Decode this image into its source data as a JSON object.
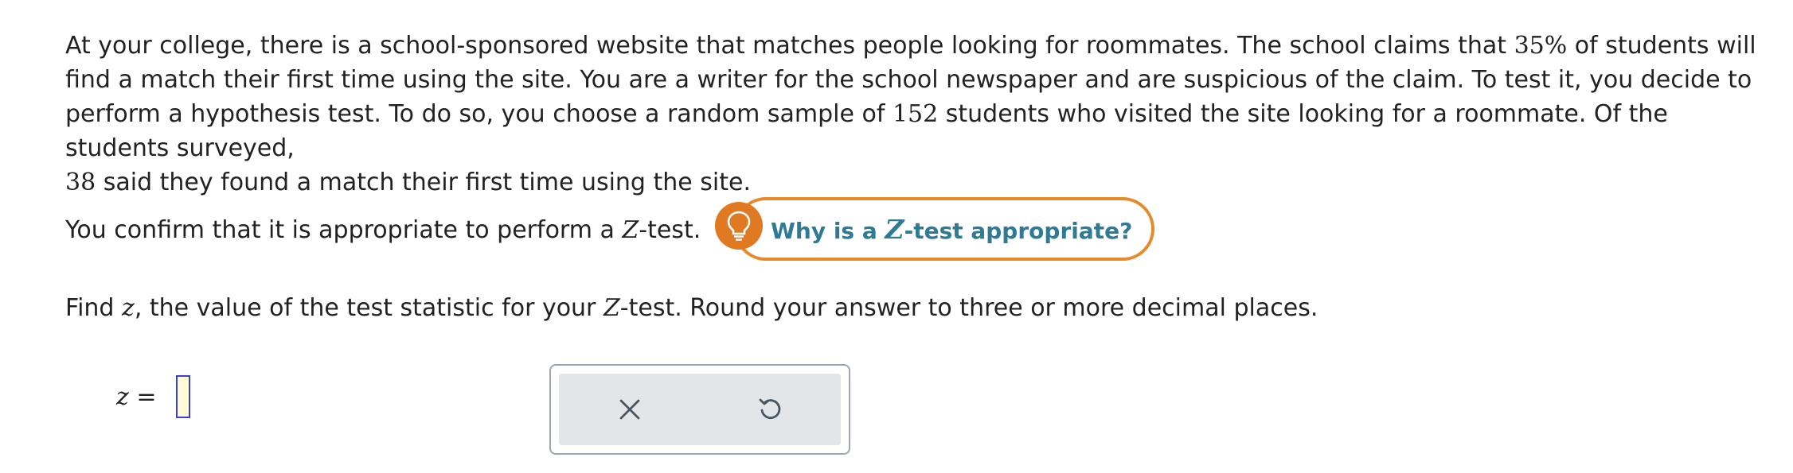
{
  "problem": {
    "p1_a": "At your college, there is a school-sponsored website that matches people looking for roommates. The school claims that ",
    "claim_pct": "35%",
    "p1_b": " of students will find a match their first time using the site. You are a writer for the school newspaper and are suspicious of the claim. To test it, you decide to perform a hypothesis test. To do so, you choose a random sample of ",
    "sample_size": "152",
    "p1_c": " students who visited the site looking for a roommate. Of the students surveyed, ",
    "successes": "38",
    "p1_d": " said they found a match their first time using the site."
  },
  "confirm": {
    "text_a": "You confirm that it is appropriate to perform a ",
    "z": "Z",
    "text_b": "-test."
  },
  "hint": {
    "label_a": "Why is a ",
    "z": "Z",
    "label_b": "-test appropriate?",
    "icon": "lightbulb-icon"
  },
  "instruction": {
    "text_a": "Find ",
    "z_var": "z",
    "text_b": ", the value of the test statistic for your ",
    "z": "Z",
    "text_c": "-test. Round your answer to three or more decimal places."
  },
  "answer": {
    "label": "z =",
    "value": ""
  },
  "actions": {
    "clear_icon": "close-icon",
    "reset_icon": "undo-icon"
  },
  "colors": {
    "hint_orange": "#e07a22",
    "hint_text": "#2f7a94",
    "input_border": "#3a3fd6",
    "input_bg": "#fffbd6",
    "panel_bg": "#e2e6e9"
  }
}
